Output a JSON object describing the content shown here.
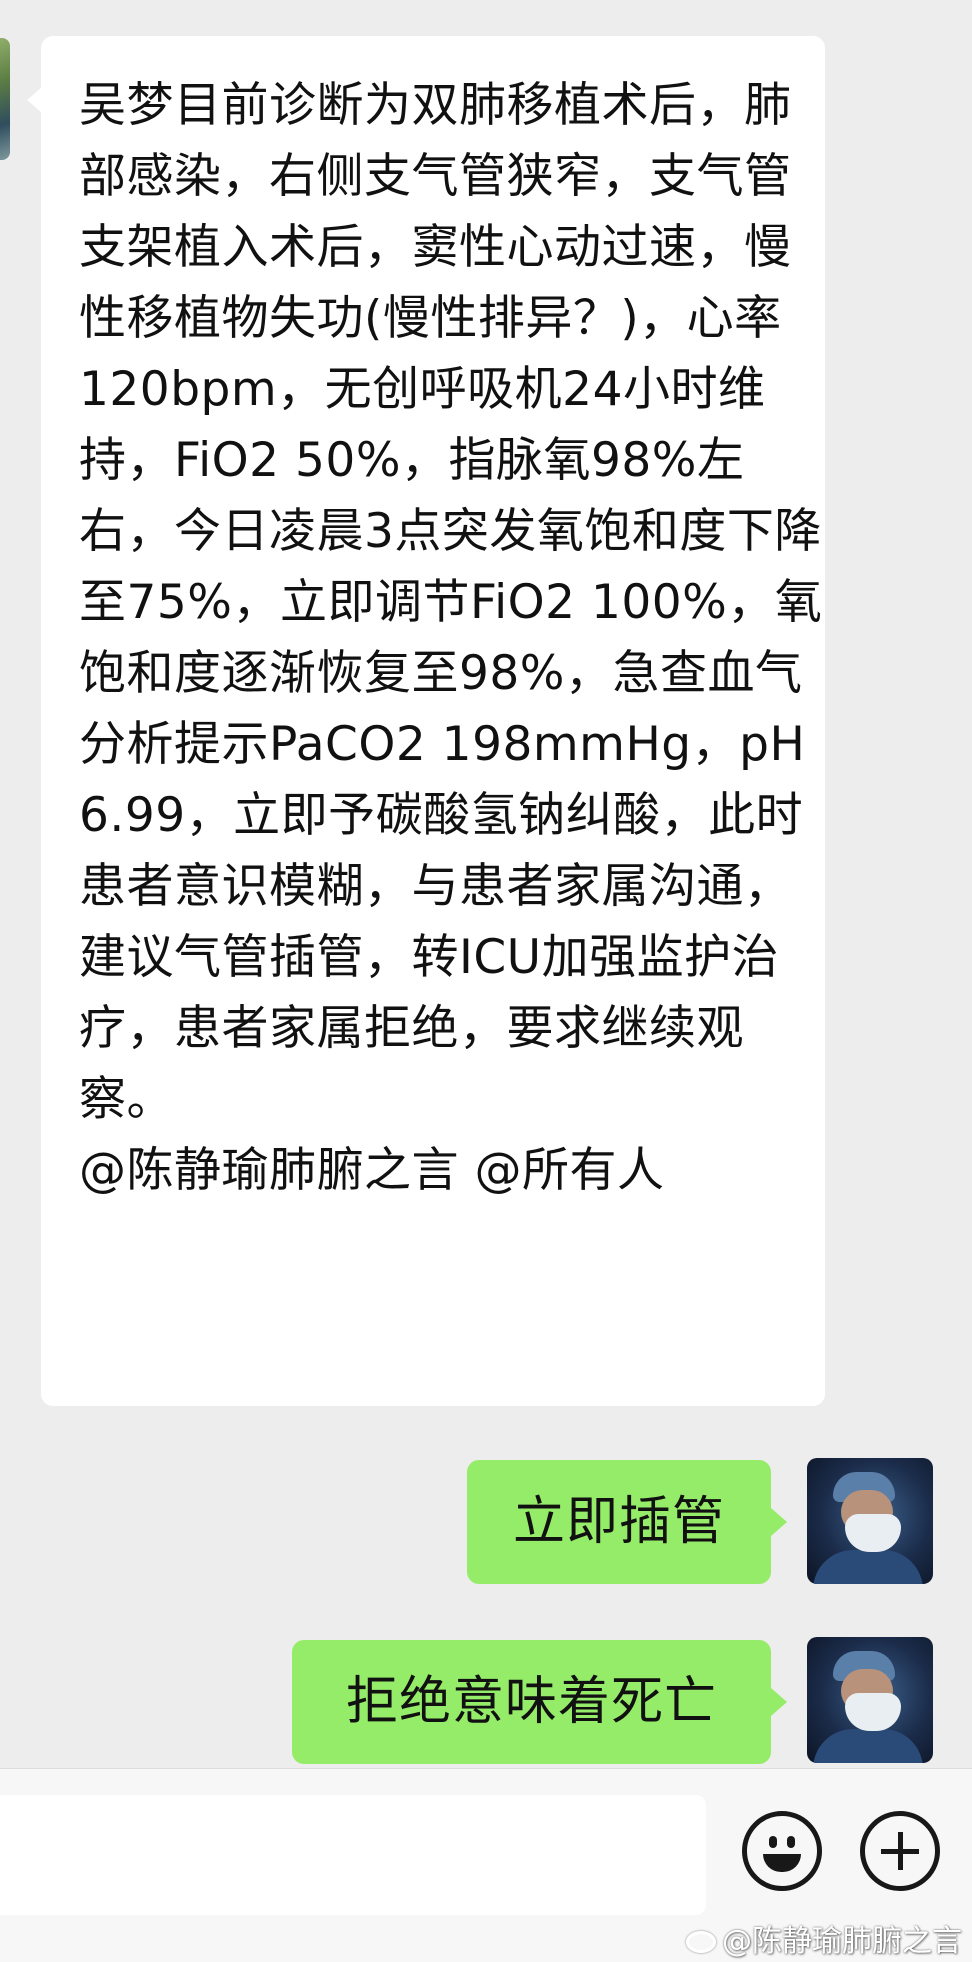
{
  "messages": {
    "incoming": {
      "text": "吴梦目前诊断为双肺移植术后，肺部感染，右侧支气管狭窄，支气管支架植入术后，窦性心动过速，慢性移植物失功(慢性排异？)，心率120bpm，无创呼吸机24小时维持，FiO2 50%，指脉氧98%左右，今日凌晨3点突发氧饱和度下降至75%，立即调节FiO2 100%，氧饱和度逐渐恢复至98%，急查血气分析提示PaCO2 198mmHg，pH 6.99，立即予碳酸氢钠纠酸，此时患者意识模糊，与患者家属沟通，建议气管插管，转ICU加强监护治疗，患者家属拒绝，要求继续观察。\n@陈静瑜肺腑之言 @所有人"
    },
    "outgoing": [
      {
        "text": "立即插管"
      },
      {
        "text": "拒绝意味着死亡"
      }
    ]
  },
  "input": {
    "value": ""
  },
  "icons": {
    "emoji": "emoji-smile-icon",
    "plus": "plus-icon",
    "watermark": "weibo-icon"
  },
  "watermark": {
    "text": "@陈静瑜肺腑之言"
  },
  "colors": {
    "background": "#ededed",
    "incoming_bubble": "#ffffff",
    "outgoing_bubble": "#95ec69",
    "bottom_bar": "#f7f7f7"
  }
}
